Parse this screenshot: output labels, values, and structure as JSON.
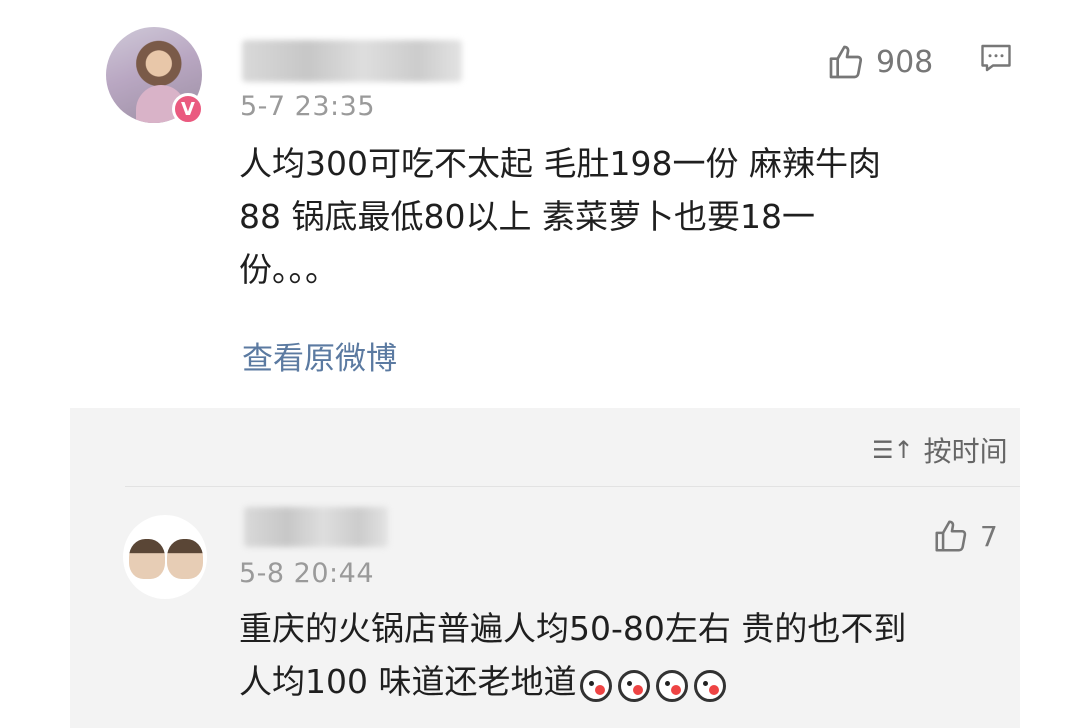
{
  "main_comment": {
    "timestamp": "5-7 23:35",
    "like_count": "908",
    "text_lines": [
      "人均300可吃不太起 毛肚198一份 麻辣牛肉",
      "88 锅底最低80以上  素菜萝卜也要18一",
      "份。。。"
    ],
    "view_original_label": "查看原微博",
    "verified_badge": "V",
    "icons": {
      "like": "thumbs-up-icon",
      "comment": "comment-icon",
      "badge": "verified-badge-icon"
    }
  },
  "sort": {
    "label": "按时间",
    "icon": "sort-icon"
  },
  "reply": {
    "timestamp": "5-8 20:44",
    "like_count": "7",
    "text_lines": [
      "重庆的火锅店普遍人均50-80左右  贵的也不到",
      "人均100  味道还老地道"
    ],
    "emoji_count": 4
  },
  "colors": {
    "link": "#5b7aa1",
    "badge": "#ea5a7f",
    "timestamp": "#9a9a9a",
    "reply_bg": "#f3f3f3"
  }
}
